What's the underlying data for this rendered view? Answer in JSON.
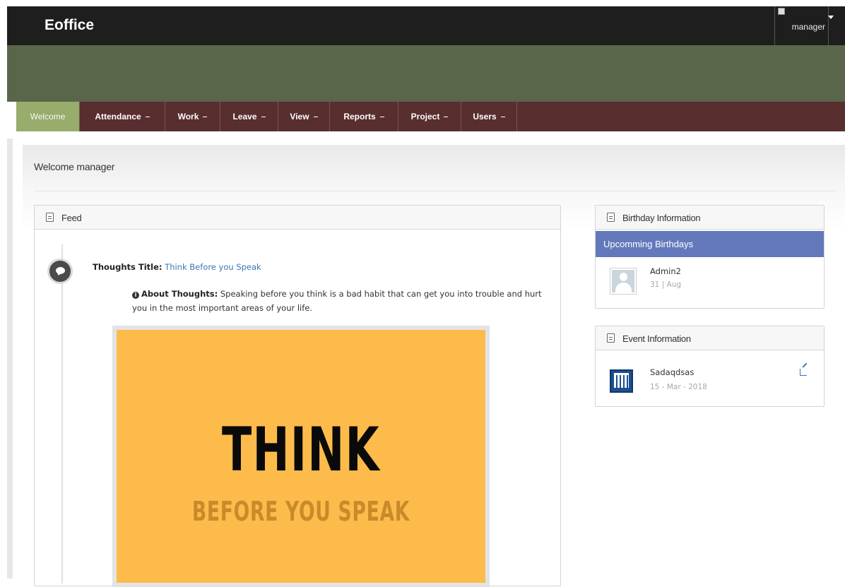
{
  "header": {
    "brand": "Eoffice",
    "user_name": "manager"
  },
  "nav": {
    "items": [
      {
        "label": "Welcome"
      },
      {
        "label": "Attendance"
      },
      {
        "label": "Work"
      },
      {
        "label": "Leave"
      },
      {
        "label": "View"
      },
      {
        "label": "Reports"
      },
      {
        "label": "Project"
      },
      {
        "label": "Users"
      }
    ]
  },
  "page": {
    "welcome_title": "Welcome manager"
  },
  "feed": {
    "title": "Feed",
    "thought_title_label": "Thoughts Title:",
    "thought_title_value": "Think Before you Speak",
    "about_label": "About Thoughts:",
    "about_text": "Speaking before you think is a bad habit that can get you into trouble and hurt you in the most important areas of your life.",
    "image_big_text": "THINK",
    "image_small_text": "BEFORE YOU SPEAK"
  },
  "birthday": {
    "title": "Birthday Information",
    "subheader": "Upcomming Birthdays",
    "entries": [
      {
        "name": "Admin2",
        "date": "31 | Aug"
      }
    ]
  },
  "event": {
    "title": "Event Information",
    "entries": [
      {
        "name": "Sadaqdsas",
        "date": "15 - Mar - 2018"
      }
    ]
  },
  "colors": {
    "topbar": "#1e1e1e",
    "banner": "#59664a",
    "navbar": "#582e2f",
    "nav_active": "#98ac6b",
    "birthday_sub": "#6479bc",
    "link": "#3b77b5",
    "thought_image_bg": "#fdbb4b"
  }
}
